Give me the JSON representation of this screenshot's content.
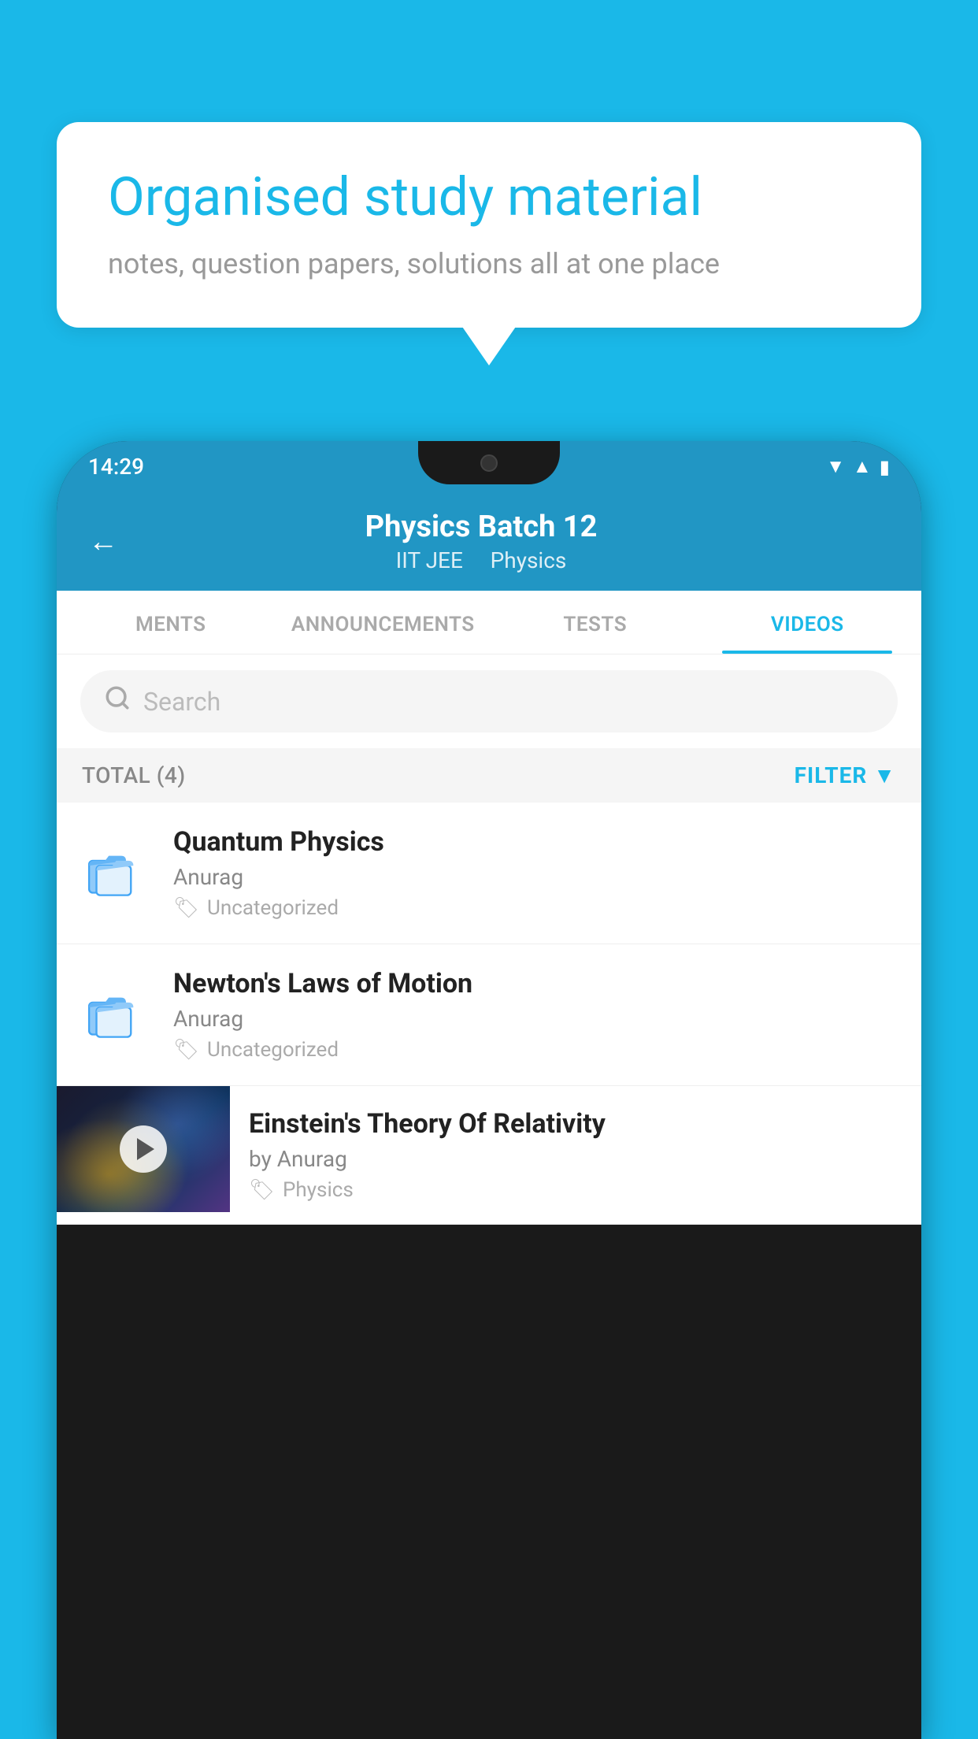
{
  "background": {
    "color": "#1ab8e8"
  },
  "speech_bubble": {
    "title": "Organised study material",
    "subtitle": "notes, question papers, solutions all at one place"
  },
  "phone": {
    "status_bar": {
      "time": "14:29",
      "wifi": "▼",
      "signal": "▲",
      "battery": "■"
    },
    "app_header": {
      "back_label": "←",
      "title": "Physics Batch 12",
      "subtitle_part1": "IIT JEE",
      "subtitle_separator": "   ",
      "subtitle_part2": "Physics"
    },
    "tabs": [
      {
        "label": "MENTS",
        "active": false
      },
      {
        "label": "ANNOUNCEMENTS",
        "active": false
      },
      {
        "label": "TESTS",
        "active": false
      },
      {
        "label": "VIDEOS",
        "active": true
      }
    ],
    "search": {
      "placeholder": "Search"
    },
    "filter_bar": {
      "total_label": "TOTAL (4)",
      "filter_label": "FILTER"
    },
    "list_items": [
      {
        "type": "folder",
        "title": "Quantum Physics",
        "author": "Anurag",
        "tag": "Uncategorized"
      },
      {
        "type": "folder",
        "title": "Newton's Laws of Motion",
        "author": "Anurag",
        "tag": "Uncategorized"
      },
      {
        "type": "video",
        "title": "Einstein's Theory Of Relativity",
        "author": "by Anurag",
        "tag": "Physics"
      }
    ]
  }
}
